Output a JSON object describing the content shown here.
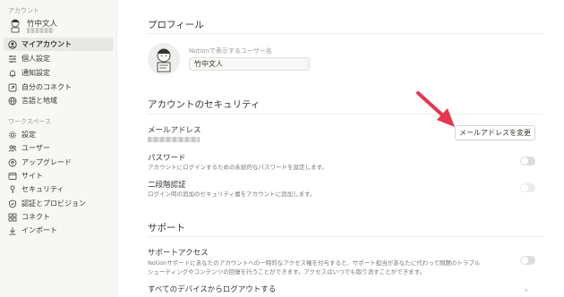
{
  "sidebar": {
    "account_section": "アカウント",
    "user_name": "竹中文人",
    "account_items": [
      {
        "label": "マイアカウント",
        "icon": "user-circle-icon"
      },
      {
        "label": "個人設定",
        "icon": "sliders-icon"
      },
      {
        "label": "通知設定",
        "icon": "bell-icon"
      },
      {
        "label": "自分のコネクト",
        "icon": "connect-icon"
      },
      {
        "label": "言語と地域",
        "icon": "globe-icon"
      }
    ],
    "workspace_section": "ワークスペース",
    "workspace_items": [
      {
        "label": "設定",
        "icon": "gear-icon"
      },
      {
        "label": "ユーザー",
        "icon": "users-icon"
      },
      {
        "label": "アップグレード",
        "icon": "upgrade-icon"
      },
      {
        "label": "サイト",
        "icon": "site-icon"
      },
      {
        "label": "セキュリティ",
        "icon": "key-icon"
      },
      {
        "label": "認証とプロビジョン",
        "icon": "shield-icon"
      },
      {
        "label": "コネクト",
        "icon": "grid-icon"
      },
      {
        "label": "インポート",
        "icon": "import-icon"
      }
    ]
  },
  "profile": {
    "heading": "プロフィール",
    "name_label": "Notionで表示するユーザー名",
    "name_value": "竹中文人"
  },
  "security": {
    "heading": "アカウントのセキュリティ",
    "email_title": "メールアドレス",
    "change_email_button": "メールアドレスを変更",
    "password_title": "パスワード",
    "password_desc": "アカウントにログインするための永続的なパスワードを設定します。",
    "twofa_title": "二段階認証",
    "twofa_desc": "ログイン時の追加のセキュリティ層をアカウントに追加します。"
  },
  "support": {
    "heading": "サポート",
    "access_title": "サポートアクセス",
    "access_desc_line1": "Notionサポートにあなたのアカウントへの一時的なアクセス権を付与すると、サポート担当があなたに代わって問題のトラブル",
    "access_desc_line2": "シューティングやコンテンツの回復を行うことができます。アクセスはいつでも取り消すことができます。",
    "logout_title": "すべてのデバイスからログアウトする"
  },
  "colors": {
    "annotation_arrow": "#e8344e",
    "sidebar_bg": "#f7f7f5"
  }
}
